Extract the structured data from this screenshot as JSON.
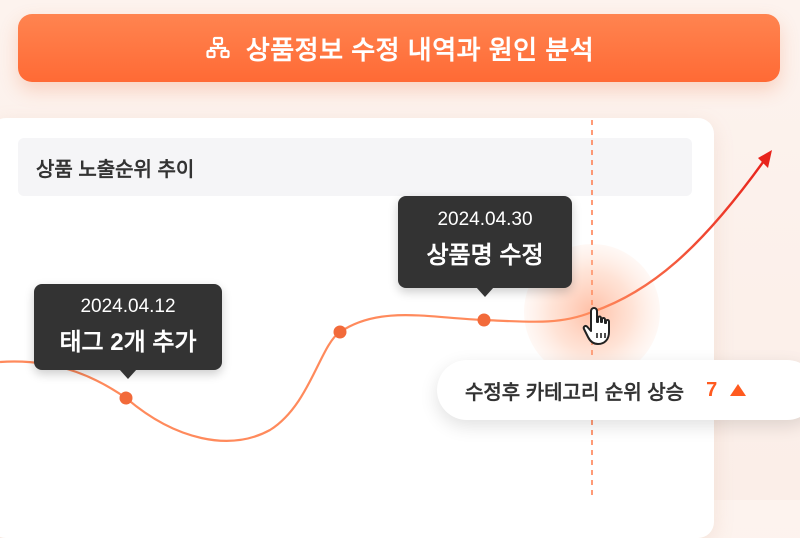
{
  "header": {
    "title": "상품정보 수정 내역과 원인 분석",
    "icon": "sitemap-icon"
  },
  "chart": {
    "title": "상품 노출순위 추이"
  },
  "annotations": [
    {
      "date": "2024.04.12",
      "label": "태그 2개 추가"
    },
    {
      "date": "2024.04.30",
      "label": "상품명 수정"
    }
  ],
  "badge": {
    "text": "수정후 카테고리 순위 상승",
    "value": "7"
  },
  "colors": {
    "accent": "#ff6a35",
    "line": "#ff8a5c",
    "rise_arrow": "#e8231b",
    "tooltip_bg": "#333333"
  }
}
